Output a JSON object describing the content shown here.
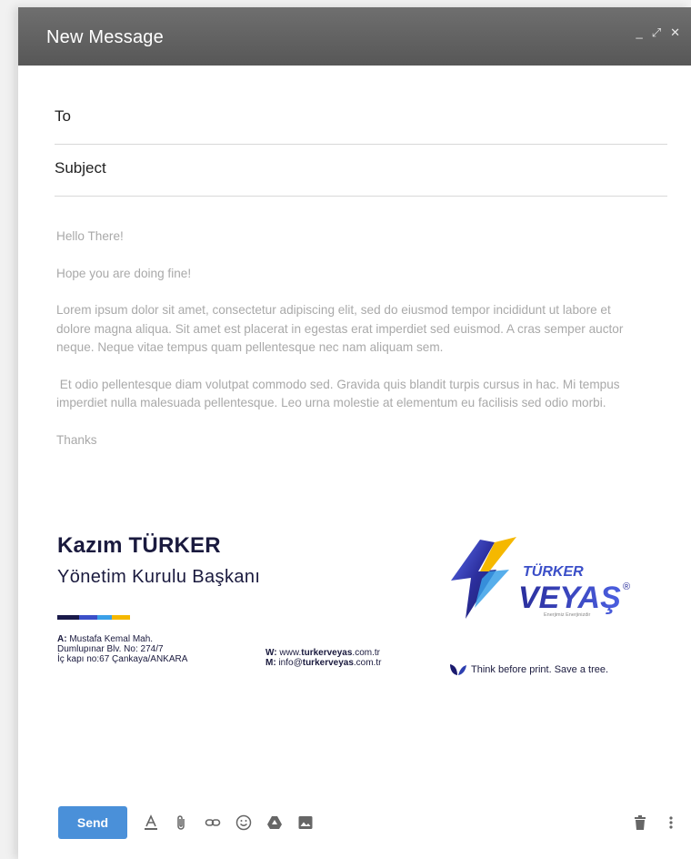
{
  "window": {
    "title": "New Message",
    "controls": {
      "minimize": "_",
      "expand": "⤢",
      "close": "✕"
    }
  },
  "fields": {
    "to_label": "To",
    "subject_label": "Subject"
  },
  "body": {
    "greeting": "Hello There!",
    "line2": "Hope you are doing fine!",
    "para1": "Lorem ipsum dolor sit amet, consectetur adipiscing elit, sed do eiusmod tempor incididunt ut labore et dolore magna aliqua. Sit amet est placerat in egestas erat imperdiet sed euismod. A cras semper auctor neque. Neque vitae tempus quam pellentesque nec nam aliquam sem.",
    "para2": " Et odio pellentesque diam volutpat commodo sed. Gravida quis blandit turpis cursus in hac. Mi tempus imperdiet nulla malesuada pellentesque. Leo urna molestie at elementum eu facilisis sed odio morbi.",
    "closing": "Thanks"
  },
  "signature": {
    "name": "Kazım TÜRKER",
    "title": "Yönetim Kurulu Başkanı",
    "bar_colors": [
      "#1a1a4a",
      "#3b4fc8",
      "#3aa0e8",
      "#f5b800"
    ],
    "address_label": "A:",
    "address_line1": " Mustafa Kemal Mah.",
    "address_line2": "Dumlupınar Blv. No: 274/7",
    "address_line3": "İç kapı no:67 Çankaya/ANKARA",
    "web_label": "W:",
    "web_prefix": " www.",
    "web_bold": "turkerveyas",
    "web_suffix": ".com.tr",
    "mail_label": "M:",
    "mail_prefix": " info@",
    "mail_bold": "turkerveyas",
    "mail_suffix": ".com.tr",
    "tree_note": "Think before print. Save a tree.",
    "logo": {
      "top_word": "TÜRKER",
      "main_word": "VEYAŞ",
      "registered": "®",
      "tagline": "Enerjimiz Enerjinizdir"
    }
  },
  "toolbar": {
    "send_label": "Send",
    "icons": [
      "text-format-icon",
      "attach-icon",
      "link-icon",
      "emoji-icon",
      "drive-icon",
      "image-icon",
      "trash-icon",
      "more-icon"
    ]
  },
  "colors": {
    "titlebar": "#5f5f5f",
    "send": "#4a90d9",
    "signature_text": "#1a1a3e"
  }
}
